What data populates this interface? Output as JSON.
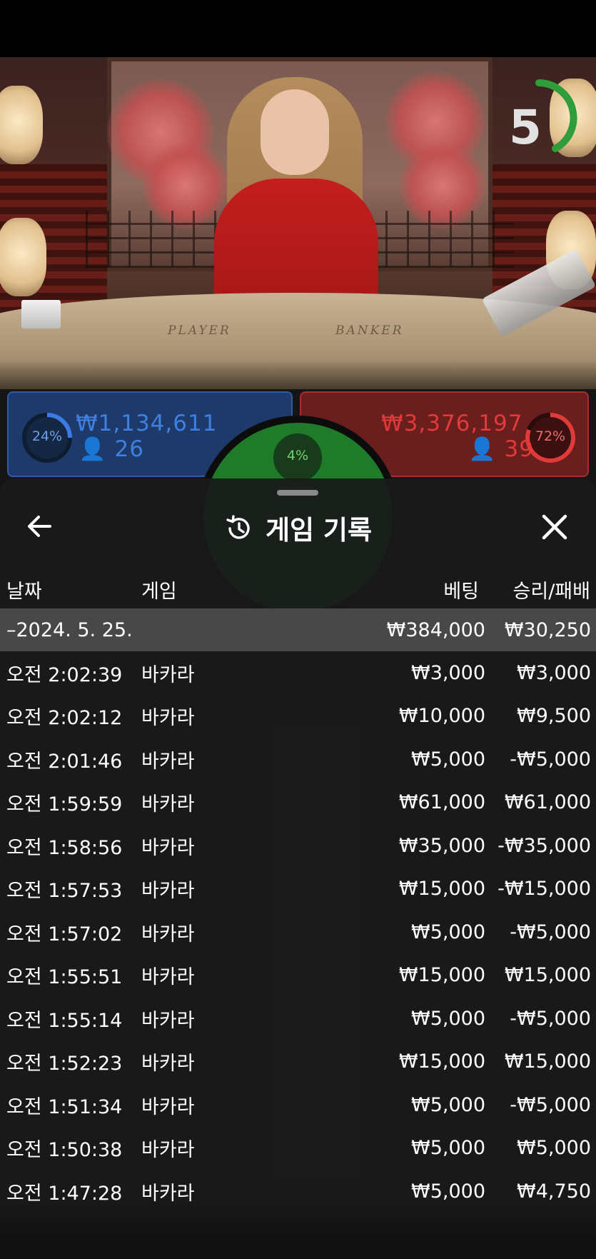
{
  "video": {
    "countdown": "5",
    "table_labels": {
      "player": "PLAYER",
      "banker": "BANKER"
    }
  },
  "bets": {
    "player": {
      "percent": "24%",
      "amount": "₩1,134,611",
      "count": "26",
      "color": "#2e6bd6"
    },
    "tie": {
      "percent": "4%",
      "color": "#4ad04a"
    },
    "banker": {
      "percent": "72%",
      "amount": "₩3,376,197",
      "count": "39",
      "color": "#e03a3a"
    }
  },
  "modal": {
    "title": "게임 기록",
    "icons": {
      "back": "arrow-left-icon",
      "history": "history-icon",
      "close": "close-icon"
    },
    "columns": {
      "date": "날짜",
      "game": "게임",
      "bet": "베팅",
      "result": "승리/패배"
    },
    "date_group": {
      "date": "–2024. 5. 25.",
      "bet_total": "₩384,000",
      "result_total": "₩30,250"
    },
    "rows": [
      {
        "time": "오전 2:02:39",
        "game": "바카라",
        "bet": "₩3,000",
        "result": "₩3,000"
      },
      {
        "time": "오전 2:02:12",
        "game": "바카라",
        "bet": "₩10,000",
        "result": "₩9,500"
      },
      {
        "time": "오전 2:01:46",
        "game": "바카라",
        "bet": "₩5,000",
        "result": "-₩5,000"
      },
      {
        "time": "오전 1:59:59",
        "game": "바카라",
        "bet": "₩61,000",
        "result": "₩61,000"
      },
      {
        "time": "오전 1:58:56",
        "game": "바카라",
        "bet": "₩35,000",
        "result": "-₩35,000"
      },
      {
        "time": "오전 1:57:53",
        "game": "바카라",
        "bet": "₩15,000",
        "result": "-₩15,000"
      },
      {
        "time": "오전 1:57:02",
        "game": "바카라",
        "bet": "₩5,000",
        "result": "-₩5,000"
      },
      {
        "time": "오전 1:55:51",
        "game": "바카라",
        "bet": "₩15,000",
        "result": "₩15,000"
      },
      {
        "time": "오전 1:55:14",
        "game": "바카라",
        "bet": "₩5,000",
        "result": "-₩5,000"
      },
      {
        "time": "오전 1:52:23",
        "game": "바카라",
        "bet": "₩15,000",
        "result": "₩15,000"
      },
      {
        "time": "오전 1:51:34",
        "game": "바카라",
        "bet": "₩5,000",
        "result": "-₩5,000"
      },
      {
        "time": "오전 1:50:38",
        "game": "바카라",
        "bet": "₩5,000",
        "result": "₩5,000"
      },
      {
        "time": "오전 1:47:28",
        "game": "바카라",
        "bet": "₩5,000",
        "result": "₩4,750"
      }
    ]
  }
}
